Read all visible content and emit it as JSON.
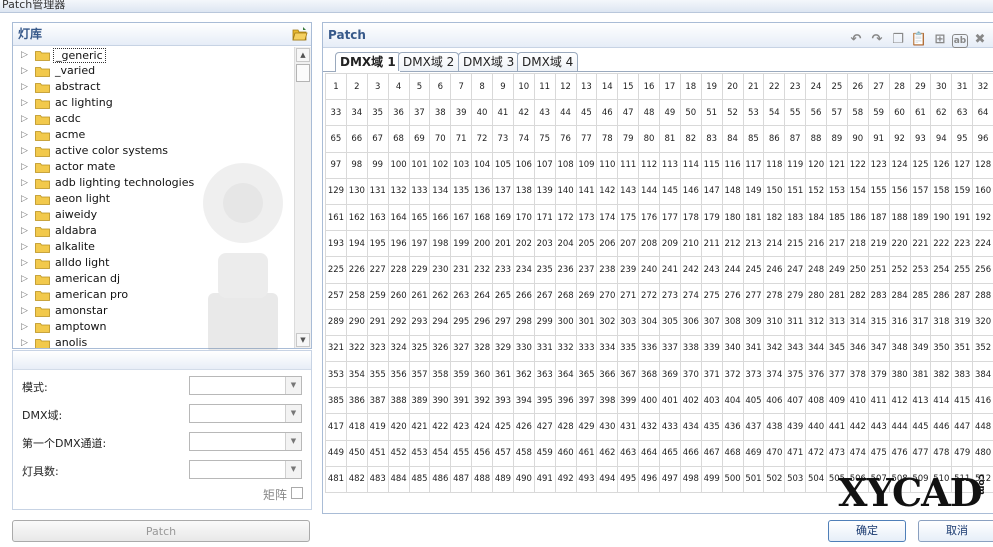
{
  "window": {
    "title": "Patch管理器"
  },
  "library": {
    "title": "灯库",
    "items": [
      "_generic",
      "_varied",
      "abstract",
      "ac lighting",
      "acdc",
      "acme",
      "active color systems",
      "actor mate",
      "adb lighting technologies",
      "aeon light",
      "aiweidy",
      "aldabra",
      "alkalite",
      "alldo light",
      "american dj",
      "american pro",
      "amonstar",
      "amptown",
      "anolis"
    ],
    "selected_index": 0
  },
  "form": {
    "mode_label": "模式:",
    "universe_label": "DMX域:",
    "first_channel_label": "第一个DMX通道:",
    "count_label": "灯具数:",
    "matrix_label": "矩阵"
  },
  "buttons": {
    "patch": "Patch",
    "ok": "确定",
    "cancel": "取消"
  },
  "patch": {
    "title": "Patch",
    "tabs": [
      "DMX域 1",
      "DMX域 2",
      "DMX域 3",
      "DMX域 4"
    ],
    "active_tab": 0,
    "toolbar_icons": [
      "undo-icon",
      "redo-icon",
      "copy-icon",
      "paste-icon",
      "insert-icon",
      "rename-icon",
      "delete-icon"
    ],
    "channel_start": 1,
    "channel_end": 512,
    "columns": 32
  },
  "watermark": {
    "text": "XYCAD",
    "suffix": "com"
  },
  "colors": {
    "accent": "#37598a",
    "border": "#a9bcd6"
  }
}
